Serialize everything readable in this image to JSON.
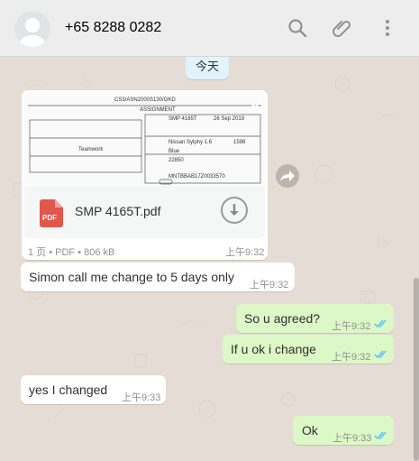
{
  "header": {
    "contact": "+65 8288 0282",
    "icons": [
      "avatar-icon",
      "search-icon",
      "attach-icon",
      "menu-icon"
    ]
  },
  "day_badge": "今天",
  "document": {
    "filename": "SMP 4165T.pdf",
    "meta": "1 页 • PDF • 806 kB",
    "time": "上午9:32",
    "preview_lines": [
      "CS3/ASN2000S130/GKD",
      "ASSIGNMENT",
      "SMP 4165T",
      "26 Sep 2019",
      "Nissan Sylphy 1.6",
      "1598",
      "Blue",
      "22850",
      "Teamwork",
      "MNTBBAB17Z0033570"
    ]
  },
  "messages": [
    {
      "dir": "in",
      "text": "Simon call me change to 5 days only",
      "time": "上午9:32"
    },
    {
      "dir": "out",
      "text": "So u agreed?",
      "time": "上午9:32"
    },
    {
      "dir": "out",
      "text": "If u ok i change",
      "time": "上午9:32"
    },
    {
      "dir": "in",
      "text": "yes I changed",
      "time": "上午9:33"
    },
    {
      "dir": "out",
      "text": "Ok",
      "time": "上午9:33"
    }
  ],
  "colors": {
    "outgoing": "#dcf8c6",
    "incoming": "#ffffff",
    "ticks": "#4fc3f7",
    "pdf": "#e2574c"
  }
}
